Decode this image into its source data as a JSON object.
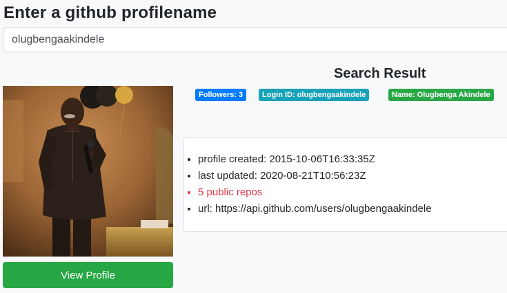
{
  "page": {
    "title": "Enter a github profilename"
  },
  "search": {
    "value": "olugbengaakindele"
  },
  "result": {
    "heading": "Search Result",
    "badges": {
      "followers": "Followers: 3",
      "login": "Login ID: olugbengaakindele",
      "name": "Name: Olugbenga Akindele"
    },
    "details": [
      "profile created: 2015-10-06T16:33:35Z",
      "last updated: 2020-08-21T10:56:23Z",
      "5 public repos",
      "url: https://api.github.com/users/olugbengaakindele"
    ]
  },
  "profile": {
    "button_label": "View Profile"
  },
  "colors": {
    "primary": "#007bff",
    "info": "#17a2b8",
    "success": "#28a745",
    "danger": "#dc3545"
  }
}
